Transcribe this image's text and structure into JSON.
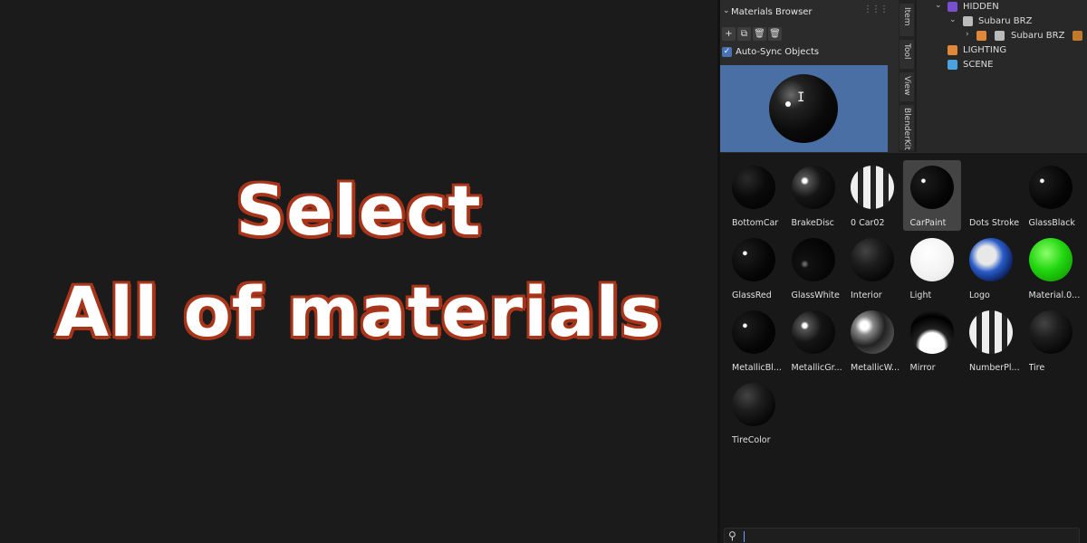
{
  "overlay": {
    "line1": "Select",
    "line2": "All of materials"
  },
  "materials_panel": {
    "title": "Materials Browser",
    "autosync_label": "Auto-Sync Objects",
    "autosync_checked": true,
    "toolbar": [
      "add-icon",
      "duplicate-icon",
      "delete-icon",
      "trash-icon"
    ]
  },
  "side_tabs": [
    "Item",
    "Tool",
    "View",
    "BlenderKit"
  ],
  "outliner": {
    "rows": [
      {
        "label": "HIDDEN",
        "icon": "collection-icon",
        "color": "#7a4ed0"
      },
      {
        "label": "Subaru BRZ",
        "icon": "collection-icon",
        "color": "#bcbcbc"
      },
      {
        "label": "Subaru BRZ",
        "icon": "object-icon",
        "color": "#e0883a"
      },
      {
        "label": "LIGHTING",
        "icon": "collection-icon",
        "color": "#e0883a"
      },
      {
        "label": "SCENE",
        "icon": "collection-icon",
        "color": "#4aa3df"
      }
    ]
  },
  "materials": [
    {
      "name": "BottomCar",
      "style": "black",
      "selected": false
    },
    {
      "name": "BrakeDisc",
      "style": "glossy",
      "selected": false
    },
    {
      "name": "0 Car02",
      "style": "striped",
      "selected": false
    },
    {
      "name": "CarPaint",
      "style": "black-dot",
      "selected": true
    },
    {
      "name": "Dots Stroke",
      "style": "none",
      "selected": false
    },
    {
      "name": "GlassBlack",
      "style": "black-dot",
      "selected": false
    },
    {
      "name": "GlassRed",
      "style": "black-dot",
      "selected": false
    },
    {
      "name": "GlassWhite",
      "style": "dark",
      "selected": false
    },
    {
      "name": "Interior",
      "style": "dark-gray",
      "selected": false
    },
    {
      "name": "Light",
      "style": "white",
      "selected": false
    },
    {
      "name": "Logo",
      "style": "logo",
      "selected": false
    },
    {
      "name": "Material.0...",
      "style": "green",
      "selected": false
    },
    {
      "name": "MetallicBl...",
      "style": "black-dot",
      "selected": false
    },
    {
      "name": "MetallicGr...",
      "style": "glossy",
      "selected": false
    },
    {
      "name": "MetallicW...",
      "style": "metal-white",
      "selected": false
    },
    {
      "name": "Mirror",
      "style": "mirror",
      "selected": false
    },
    {
      "name": "NumberPl...",
      "style": "striped",
      "selected": false
    },
    {
      "name": "Tire",
      "style": "dark-gray",
      "selected": false
    },
    {
      "name": "TireColor",
      "style": "dark-gray",
      "selected": false
    }
  ],
  "search": {
    "value": "",
    "placeholder": ""
  }
}
